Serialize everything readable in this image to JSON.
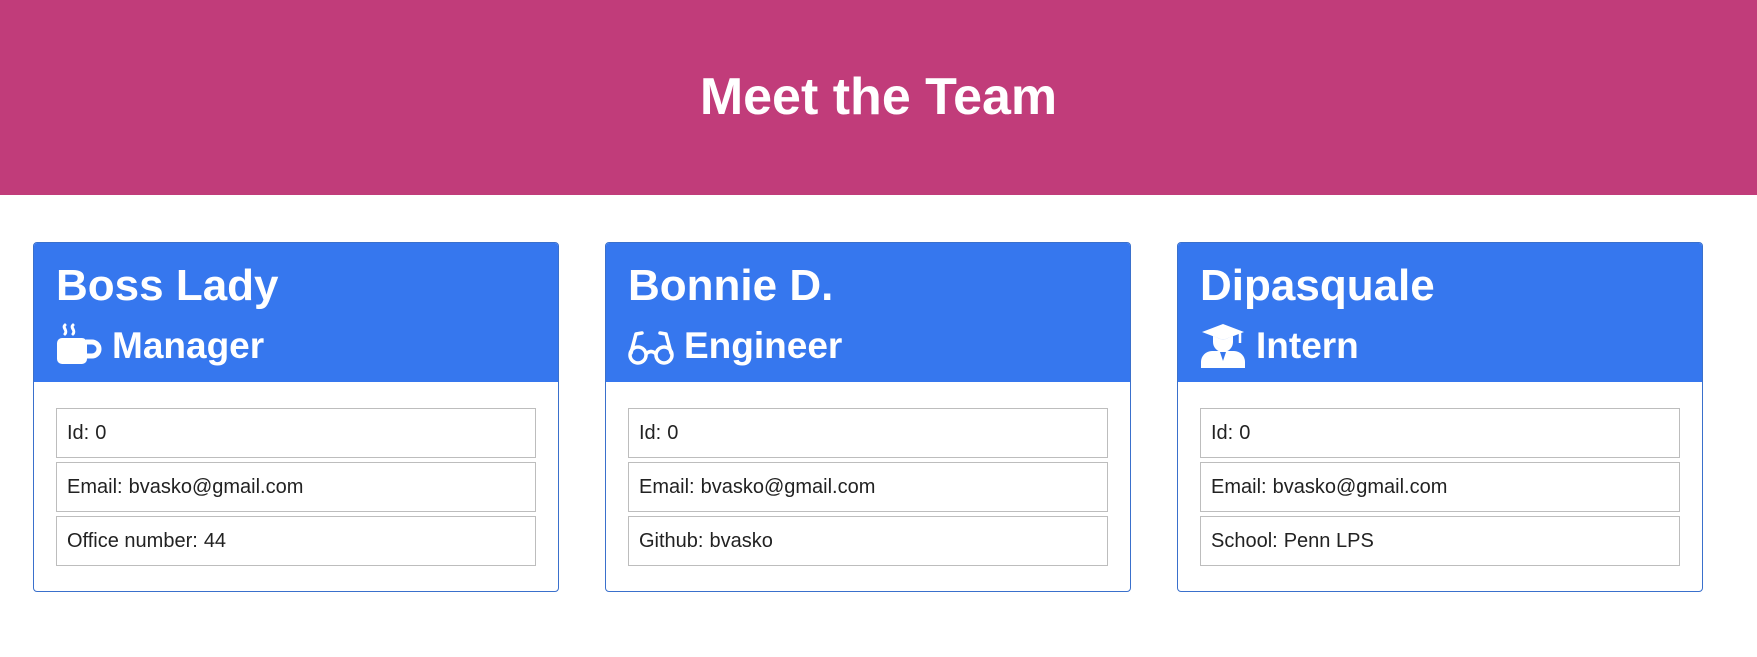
{
  "header": {
    "title": "Meet the Team"
  },
  "colors": {
    "banner": "#c13c7a",
    "card_header": "#3677ee",
    "card_border": "#3a70cc"
  },
  "team": [
    {
      "name": "Boss Lady",
      "role": "Manager",
      "icon": "mug-hot-icon",
      "id_label": "Id:",
      "id": "0",
      "email_label": "Email:",
      "email": "bvasko@gmail.com",
      "extra_label": "Office number:",
      "extra": "44"
    },
    {
      "name": "Bonnie D.",
      "role": "Engineer",
      "icon": "glasses-icon",
      "id_label": "Id:",
      "id": "0",
      "email_label": "Email:",
      "email": "bvasko@gmail.com",
      "extra_label": "Github:",
      "extra": "bvasko"
    },
    {
      "name": "Dipasquale",
      "role": "Intern",
      "icon": "user-graduate-icon",
      "id_label": "Id:",
      "id": "0",
      "email_label": "Email:",
      "email": "bvasko@gmail.com",
      "extra_label": "School:",
      "extra": "Penn LPS"
    }
  ]
}
